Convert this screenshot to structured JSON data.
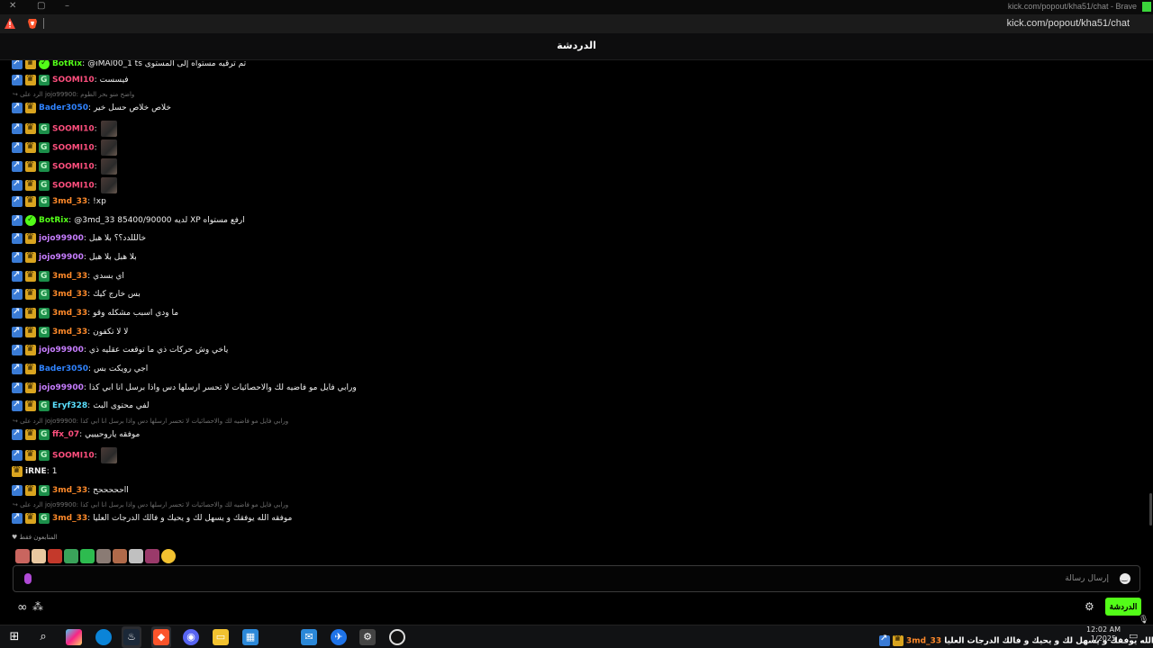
{
  "window": {
    "title": "kick.com/popout/kha51/chat - Brave"
  },
  "address_bar": {
    "url": "kick.com/popout/kha51/chat"
  },
  "chat": {
    "title": "الدردشة"
  },
  "messages": [
    {
      "username": "BotRix",
      "color": "#53fc18",
      "text": "@iMAl00_1 ts تم ترقيه مستواه إلى المستوى",
      "badges": [
        "arrow",
        "crown",
        "bot"
      ]
    },
    {
      "username": "SOOMI10",
      "color": "#ff4f7e",
      "text": "فيسست",
      "badges": [
        "arrow",
        "crown",
        "sub"
      ]
    },
    {
      "reply_context": "الرد على jojo99900: واضح منو بحر الطوم"
    },
    {
      "username": "Bader3050",
      "color": "#2f83ff",
      "text": "خلاص خلاص حسل خير",
      "badges": [
        "arrow",
        "crown"
      ]
    },
    {
      "username": "SOOMI10",
      "color": "#ff4f7e",
      "text": "",
      "emote": true,
      "badges": [
        "arrow",
        "crown",
        "sub"
      ]
    },
    {
      "username": "SOOMI10",
      "color": "#ff4f7e",
      "text": "",
      "emote": true,
      "badges": [
        "arrow",
        "crown",
        "sub"
      ]
    },
    {
      "username": "SOOMI10",
      "color": "#ff4f7e",
      "text": "",
      "emote": true,
      "badges": [
        "arrow",
        "crown",
        "sub"
      ]
    },
    {
      "username": "SOOMI10",
      "color": "#ff4f7e",
      "text": "",
      "emote": true,
      "badges": [
        "arrow",
        "crown",
        "sub"
      ]
    },
    {
      "username": "3md_33",
      "color": "#ff8a2a",
      "text": "!xp",
      "badges": [
        "arrow",
        "crown",
        "sub"
      ]
    },
    {
      "username": "BotRix",
      "color": "#53fc18",
      "text": "@3md_33 85400/90000 لديه XP ارفع مستواه",
      "badges": [
        "arrow",
        "bot"
      ]
    },
    {
      "username": "jojo99900",
      "color": "#c77dff",
      "text": "خالللدد؟؟ بلا هبل",
      "badges": [
        "arrow",
        "crown"
      ]
    },
    {
      "username": "jojo99900",
      "color": "#c77dff",
      "text": "بلا هبل بلا هبل",
      "badges": [
        "arrow",
        "crown"
      ]
    },
    {
      "username": "3md_33",
      "color": "#ff8a2a",
      "text": "اي بسدي",
      "badges": [
        "arrow",
        "crown",
        "sub"
      ]
    },
    {
      "username": "3md_33",
      "color": "#ff8a2a",
      "text": "بس خارج كيك",
      "badges": [
        "arrow",
        "crown",
        "sub"
      ]
    },
    {
      "username": "3md_33",
      "color": "#ff8a2a",
      "text": "ما ودي اسبب مشكله وقو",
      "badges": [
        "arrow",
        "crown",
        "sub"
      ]
    },
    {
      "username": "3md_33",
      "color": "#ff8a2a",
      "text": "لا لا تكفون",
      "badges": [
        "arrow",
        "crown",
        "sub"
      ]
    },
    {
      "username": "jojo99900",
      "color": "#c77dff",
      "text": "ياخي وش حركات ذي ما توقعت عقليه ذي",
      "badges": [
        "arrow",
        "crown"
      ]
    },
    {
      "username": "Bader3050",
      "color": "#2f83ff",
      "text": "اجي رويكت بس",
      "badges": [
        "arrow",
        "crown"
      ]
    },
    {
      "username": "jojo99900",
      "color": "#c77dff",
      "text": "ورابي فايل مو فاضيه لك والاحصائيات لا تحسر ارسلها دس واذا برسل انا ابي كذا",
      "badges": [
        "arrow",
        "crown"
      ]
    },
    {
      "username": "Eryf328",
      "color": "#5be0ff",
      "text": "لفي محتوى البث",
      "badges": [
        "arrow",
        "crown",
        "sub"
      ]
    },
    {
      "reply_context": "الرد على jojo99900: ورابي فايل مو فاضيه لك والاحصائيات لا تحسر ارسلها دس واذا برسل انا ابي كذا"
    },
    {
      "username": "ffx_07",
      "color": "#ff4f7e",
      "text": "موفقه ياروحيييي",
      "badges": [
        "arrow",
        "crown",
        "sub"
      ]
    },
    {
      "username": "SOOMI10",
      "color": "#ff4f7e",
      "text": "",
      "emote": true,
      "badges": [
        "arrow",
        "crown",
        "sub"
      ]
    },
    {
      "username": "iRNE",
      "color": "#f0f0f0",
      "text": "1",
      "badges": [
        "crown"
      ]
    },
    {
      "username": "3md_33",
      "color": "#ff8a2a",
      "text": "ااحححححح",
      "badges": [
        "arrow",
        "crown",
        "sub"
      ]
    },
    {
      "reply_context": "الرد على jojo99900: ورابي فايل مو فاضيه لك والاحصائيات لا تحسر ارسلها دس واذا برسل انا ابي كذا"
    },
    {
      "username": "3md_33",
      "color": "#ff8a2a",
      "text": "موفقه الله يوفقك و يسهل لك و يحيك و فالك الدرجات العليا",
      "badges": [
        "arrow",
        "crown",
        "sub"
      ]
    }
  ],
  "viewers": {
    "label": "المتابعون فقط",
    "avatar_colors": [
      "#c9655f",
      "#e8c8a0",
      "#c4392b",
      "#3aa35a",
      "#2dbb4f",
      "#8a7b74",
      "#b06a4a",
      "#c0c0c0",
      "#9a3a6a",
      "#f2c230"
    ]
  },
  "input": {
    "placeholder": "إرسال رسالة"
  },
  "footer": {
    "chat_button_label": "الدردشة"
  },
  "taskbar": {
    "ticker_user": "3md_33",
    "ticker_text": "موفقه الله يوفقك و يسهل لك و يحيك و فالك الدرجات العليا :",
    "time": "12:02 AM",
    "date": "1/2025"
  },
  "colors": {
    "kick_green": "#53fc18",
    "background": "#000000"
  }
}
